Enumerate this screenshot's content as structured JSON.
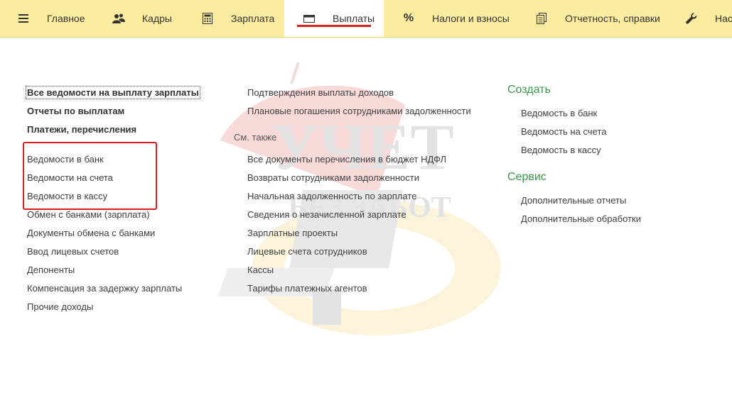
{
  "sections": [
    {
      "label": "Главное",
      "icon": "menu-icon"
    },
    {
      "label": "Кадры",
      "icon": "people-icon"
    },
    {
      "label": "Зарплата",
      "icon": "calculator-icon"
    },
    {
      "label": "Выплаты",
      "icon": "wallet-icon",
      "active": true
    },
    {
      "label": "Налоги и взносы",
      "icon": "percent-icon"
    },
    {
      "label": "Отчетность, справки",
      "icon": "reports-icon"
    },
    {
      "label": "Нас",
      "icon": "wrench-icon"
    }
  ],
  "col1": {
    "bold": [
      "Все ведомости на выплату зарплаты",
      "Отчеты по выплатам",
      "Платежи, перечисления"
    ],
    "highlighted": [
      "Ведомости в банк",
      "Ведомости на счета",
      "Ведомости в кассу"
    ],
    "items": [
      "Обмен с банками (зарплата)",
      "Документы обмена с банками",
      "Ввод лицевых счетов",
      "Депоненты",
      "Компенсация за задержку зарплаты",
      "Прочие доходы"
    ]
  },
  "col2": {
    "items": [
      "Подтверждения выплаты доходов",
      "Плановые погашения сотрудниками задолженности"
    ],
    "see_also_label": "См. также",
    "see_also": [
      "Все документы перечисления в бюджет НДФЛ",
      "Возвраты сотрудниками задолженности",
      "Начальная задолженность по зарплате",
      "Сведения о незачисленной зарплате",
      "Зарплатные проекты",
      "Лицевые счета сотрудников",
      "Кассы",
      "Тарифы платежных агентов"
    ]
  },
  "col3": {
    "create_title": "Создать",
    "create": [
      "Ведомость в банк",
      "Ведомость на счета",
      "Ведомость в кассу"
    ],
    "service_title": "Сервис",
    "service": [
      "Дополнительные отчеты",
      "Дополнительные обработки"
    ]
  },
  "watermark": {
    "line1": "УЧЕТ",
    "line2": "БЕЗ ЗАБОТ"
  },
  "colors": {
    "bar": "#fbeca0",
    "accent": "#d9201b",
    "green": "#3a9a4a"
  }
}
